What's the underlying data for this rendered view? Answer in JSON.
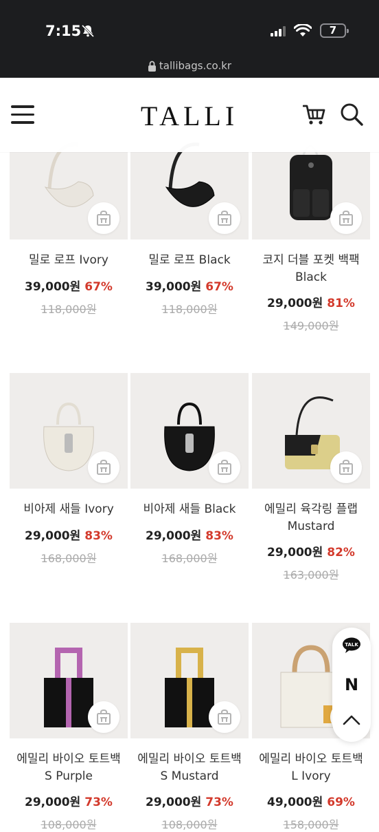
{
  "status_bar": {
    "time": "7:15",
    "battery": "7"
  },
  "browser": {
    "url": "tallibags.co.kr"
  },
  "header": {
    "logo": "TALLI"
  },
  "products": [
    {
      "name_line1": "밀로 로프 Ivory",
      "name_line2": "",
      "price": "39,000원",
      "discount": "67%",
      "original": "118,000원",
      "bag_color": "#e9e5de"
    },
    {
      "name_line1": "밀로 로프 Black",
      "name_line2": "",
      "price": "39,000원",
      "discount": "67%",
      "original": "118,000원",
      "bag_color": "#1b1b1b"
    },
    {
      "name_line1": "코지 더블 포켓 백팩",
      "name_line2": "Black",
      "price": "29,000원",
      "discount": "81%",
      "original": "149,000원",
      "bag_color": "#1e1e1e"
    },
    {
      "name_line1": "비아제 새들 Ivory",
      "name_line2": "",
      "price": "29,000원",
      "discount": "83%",
      "original": "168,000원",
      "bag_color": "#ede9df"
    },
    {
      "name_line1": "비아제 새들 Black",
      "name_line2": "",
      "price": "29,000원",
      "discount": "83%",
      "original": "168,000원",
      "bag_color": "#161616"
    },
    {
      "name_line1": "에밀리 육각링 플랩",
      "name_line2": "Mustard",
      "price": "29,000원",
      "discount": "82%",
      "original": "163,000원",
      "bag_color": "#dccf8a"
    },
    {
      "name_line1": "에밀리 바이오 토트백",
      "name_line2": "S Purple",
      "price": "29,000원",
      "discount": "73%",
      "original": "108,000원",
      "bag_color": "#b465b0"
    },
    {
      "name_line1": "에밀리 바이오 토트백",
      "name_line2": "S Mustard",
      "price": "29,000원",
      "discount": "73%",
      "original": "108,000원",
      "bag_color": "#d8b24a"
    },
    {
      "name_line1": "에밀리 바이오 토트백",
      "name_line2": "L Ivory",
      "price": "49,000원",
      "discount": "69%",
      "original": "158,000원",
      "bag_color": "#f1eee6"
    }
  ],
  "floating": {
    "talk_label": "TALK",
    "n_label": "N"
  }
}
